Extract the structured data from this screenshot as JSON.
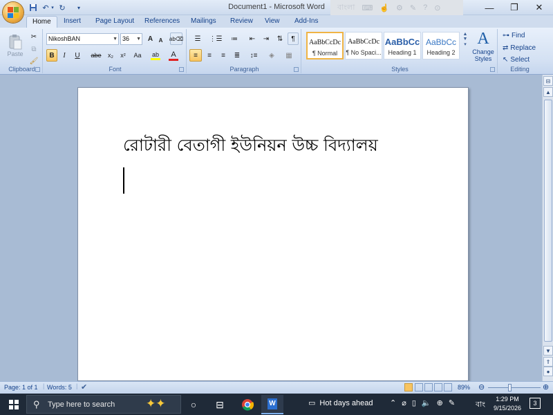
{
  "window": {
    "title": "Document1 - Microsoft Word",
    "controls": {
      "minimize": "—",
      "restore": "❐",
      "close": "✕"
    }
  },
  "language_bar": {
    "label": "বাংলা"
  },
  "quick_access": {
    "save_icon": "save-icon",
    "undo_icon": "undo-icon",
    "redo_icon": "redo-icon",
    "customize_icon": "customize-qat-icon"
  },
  "tabs": [
    "Home",
    "Insert",
    "Page Layout",
    "References",
    "Mailings",
    "Review",
    "View",
    "Add-Ins"
  ],
  "active_tab": "Home",
  "ribbon": {
    "clipboard": {
      "paste_label": "Paste",
      "group_label": "Clipboard"
    },
    "font": {
      "font_name": "NikoshBAN",
      "font_size": "36",
      "group_label": "Font",
      "buttons": {
        "bold": "B",
        "italic": "I",
        "underline": "U",
        "strike": "abe",
        "subscript": "x₂",
        "superscript": "x²",
        "change_case": "Aa",
        "grow": "A",
        "shrink": "A"
      }
    },
    "paragraph": {
      "group_label": "Paragraph",
      "show_marks": "¶"
    },
    "styles": {
      "group_label": "Styles",
      "tiles": [
        {
          "sample": "AaBbCcDc",
          "name": "¶ Normal"
        },
        {
          "sample": "AaBbCcDc",
          "name": "¶ No Spaci..."
        },
        {
          "sample": "AaBbCc",
          "name": "Heading 1"
        },
        {
          "sample": "AaBbCc",
          "name": "Heading 2"
        }
      ],
      "change_styles_label": "Change Styles",
      "accent_color": "#1f5fa8"
    },
    "editing": {
      "group_label": "Editing",
      "find": "Find",
      "replace": "Replace",
      "select": "Select"
    }
  },
  "document": {
    "text": "রোটারী বেতাগী ইউনিয়ন উচ্চ বিদ্যালয়"
  },
  "status": {
    "page": "Page: 1 of 1",
    "words": "Words: 5",
    "zoom": "89%"
  },
  "taskbar": {
    "search_placeholder": "Type here to search",
    "weather": "Hot days ahead",
    "language": "বাং",
    "time": "1:29 PM",
    "date": "9/15/2026",
    "notification_count": "3"
  }
}
